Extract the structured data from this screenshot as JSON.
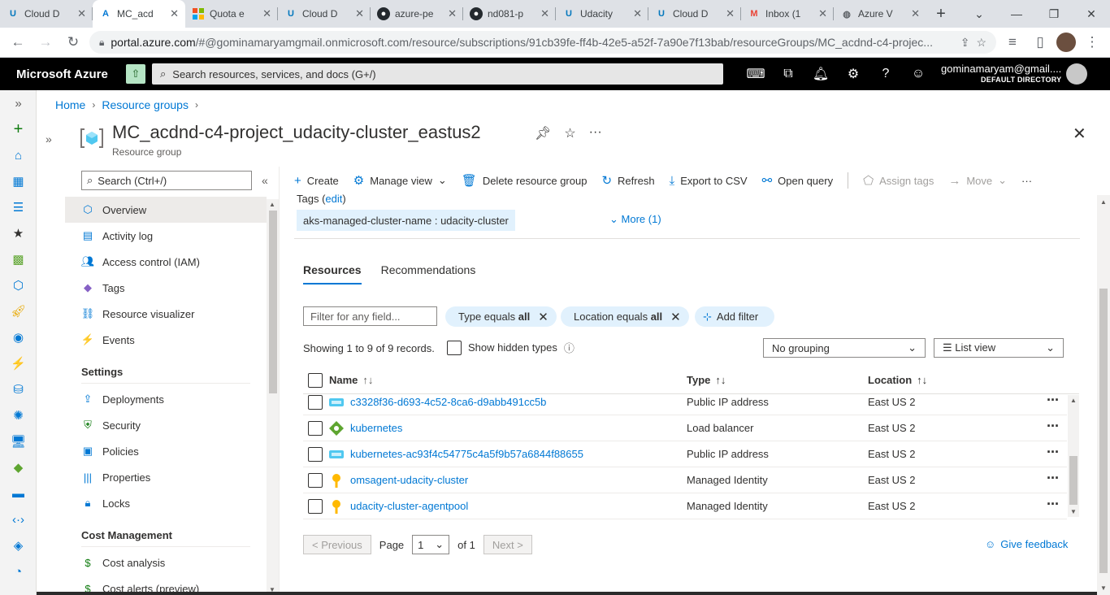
{
  "browser": {
    "tabs": [
      {
        "label": "Cloud D",
        "icon": "udacity-icon",
        "color": "#0277bd",
        "active": false
      },
      {
        "label": "MC_acd",
        "icon": "azure-icon",
        "color": "#0078d4",
        "active": true
      },
      {
        "label": "Quota e",
        "icon": "microsoft-icon",
        "color": "#f25022",
        "active": false
      },
      {
        "label": "Cloud D",
        "icon": "udacity-icon",
        "color": "#0277bd",
        "active": false
      },
      {
        "label": "azure-pe",
        "icon": "github-icon",
        "color": "#24292e",
        "active": false
      },
      {
        "label": "nd081-p",
        "icon": "github-icon",
        "color": "#24292e",
        "active": false
      },
      {
        "label": "Udacity",
        "icon": "udacity-icon",
        "color": "#0277bd",
        "active": false
      },
      {
        "label": "Cloud D",
        "icon": "udacity-icon",
        "color": "#0277bd",
        "active": false
      },
      {
        "label": "Inbox (1",
        "icon": "gmail-icon",
        "color": "#ea4335",
        "active": false
      },
      {
        "label": "Azure V",
        "icon": "globe-icon",
        "color": "#5f6368",
        "active": false
      }
    ],
    "url_host": "portal.azure.com",
    "url_path": "/#@gominamaryamgmail.onmicrosoft.com/resource/subscriptions/91cb39fe-ff4b-42e5-a52f-7a90e7f13bab/resourceGroups/MC_acdnd-c4-projec..."
  },
  "azure": {
    "brand": "Microsoft Azure",
    "search_placeholder": "Search resources, services, and docs (G+/)",
    "user_email": "gominamaryam@gmail....",
    "user_directory": "DEFAULT DIRECTORY"
  },
  "breadcrumb": [
    "Home",
    "Resource groups"
  ],
  "blade": {
    "title": "MC_acdnd-c4-project_udacity-cluster_eastus2",
    "subtitle": "Resource group"
  },
  "menu": {
    "search_placeholder": "Search (Ctrl+/)",
    "items": [
      {
        "label": "Overview",
        "icon": "overview-icon",
        "active": true
      },
      {
        "label": "Activity log",
        "icon": "activity-log-icon"
      },
      {
        "label": "Access control (IAM)",
        "icon": "iam-icon"
      },
      {
        "label": "Tags",
        "icon": "tag-icon"
      },
      {
        "label": "Resource visualizer",
        "icon": "visualizer-icon"
      },
      {
        "label": "Events",
        "icon": "events-icon"
      }
    ],
    "settings_title": "Settings",
    "settings_items": [
      {
        "label": "Deployments",
        "icon": "deployments-icon"
      },
      {
        "label": "Security",
        "icon": "security-icon"
      },
      {
        "label": "Policies",
        "icon": "policies-icon"
      },
      {
        "label": "Properties",
        "icon": "properties-icon"
      },
      {
        "label": "Locks",
        "icon": "lock-icon"
      }
    ],
    "cost_title": "Cost Management",
    "cost_items": [
      {
        "label": "Cost analysis",
        "icon": "cost-analysis-icon"
      },
      {
        "label": "Cost alerts (preview)",
        "icon": "cost-alerts-icon"
      }
    ]
  },
  "commands": {
    "create": "Create",
    "manage_view": "Manage view",
    "delete": "Delete resource group",
    "refresh": "Refresh",
    "export": "Export to CSV",
    "open_query": "Open query",
    "assign_tags": "Assign tags",
    "move": "Move"
  },
  "tags": {
    "label": "Tags",
    "edit": "edit",
    "chip": "aks-managed-cluster-name : udacity-cluster",
    "more": "More (1)"
  },
  "tabs": {
    "resources": "Resources",
    "recommendations": "Recommendations"
  },
  "filters": {
    "field_placeholder": "Filter for any field...",
    "type_prefix": "Type equals",
    "type_value": "all",
    "location_prefix": "Location equals",
    "location_value": "all",
    "add_filter": "Add filter"
  },
  "records": {
    "showing": "Showing 1 to 9 of 9 records.",
    "show_hidden": "Show hidden types",
    "grouping": "No grouping",
    "view": "List view"
  },
  "table": {
    "headers": {
      "name": "Name",
      "type": "Type",
      "location": "Location"
    },
    "rows": [
      {
        "name": "c3328f36-d693-4c52-8ca6-d9abb491cc5b",
        "type": "Public IP address",
        "location": "East US 2",
        "icon": "public-ip-icon"
      },
      {
        "name": "kubernetes",
        "type": "Load balancer",
        "location": "East US 2",
        "icon": "load-balancer-icon"
      },
      {
        "name": "kubernetes-ac93f4c54775c4a5f9b57a6844f88655",
        "type": "Public IP address",
        "location": "East US 2",
        "icon": "public-ip-icon"
      },
      {
        "name": "omsagent-udacity-cluster",
        "type": "Managed Identity",
        "location": "East US 2",
        "icon": "managed-identity-icon"
      },
      {
        "name": "udacity-cluster-agentpool",
        "type": "Managed Identity",
        "location": "East US 2",
        "icon": "managed-identity-icon"
      }
    ]
  },
  "pager": {
    "previous": "< Previous",
    "page_label": "Page",
    "page_value": "1",
    "of": "of 1",
    "next": "Next >"
  },
  "feedback": "Give feedback"
}
